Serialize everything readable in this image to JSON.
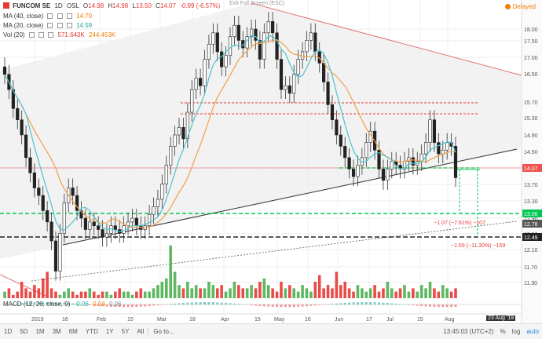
{
  "header": {
    "symbol": "FUNCOM SE",
    "interval": "1D",
    "exchange": "OSL",
    "ohlc": {
      "o_label": "O",
      "o": "14.98",
      "h_label": "H",
      "h": "14.98",
      "l_label": "L",
      "l": "13.50",
      "c_label": "C",
      "c": "14.07",
      "change": "-0.99 (-6.57%)"
    },
    "exit_fullscreen": "Exit Full Screen (ESC)",
    "delayed": "Delayed"
  },
  "indicators": {
    "ma40": {
      "label": "MA (40, close)",
      "value": "14.70"
    },
    "ma20": {
      "label": "MA (20, close)",
      "value": "14.59"
    },
    "vol": {
      "label": "Vol (20)",
      "value1": "571.643K",
      "value2": "244.453K"
    },
    "macd": {
      "label": "MACD (12, 26, close, 9)",
      "value1": "-0.06",
      "value2": "0.04",
      "value3": "0.06"
    }
  },
  "price_axis": {
    "ticks": [
      "18.00",
      "17.50",
      "17.00",
      "16.50",
      "15.70",
      "15.30",
      "14.90",
      "14.50",
      "14.10",
      "13.70",
      "13.30",
      "12.90",
      "12.50",
      "12.10",
      "11.70",
      "11.30"
    ],
    "current_price": "14.07",
    "level_13": "13.00",
    "level_1278": "12.78",
    "level_1249": "12.49"
  },
  "time_axis": {
    "labels": [
      "2019",
      "16",
      "Feb",
      "15",
      "Mar",
      "18",
      "Apr",
      "15",
      "May",
      "16",
      "Jun",
      "17",
      "Jul",
      "15",
      "Aug"
    ],
    "cursor_date": "23 Aug '19"
  },
  "annotations": {
    "measure1": "−1.07 (−7.61%) −107",
    "measure2": "−1.59 (−11.30%) −159"
  },
  "toolbar": {
    "timeframes": [
      "1D",
      "5D",
      "1M",
      "3M",
      "6M",
      "YTD",
      "1Y",
      "5Y",
      "All"
    ],
    "goto": "Go to...",
    "time": "13:45:03 (UTC+2)",
    "pct": "%",
    "log": "log",
    "auto": "auto"
  },
  "colors": {
    "ma40": "#f0a04b",
    "ma20": "#4fc3d1",
    "up": "#26a69a",
    "down": "#ef5350",
    "resistance": "#e57373",
    "support_green": "#00c853",
    "accent": "#1e88e5"
  }
}
